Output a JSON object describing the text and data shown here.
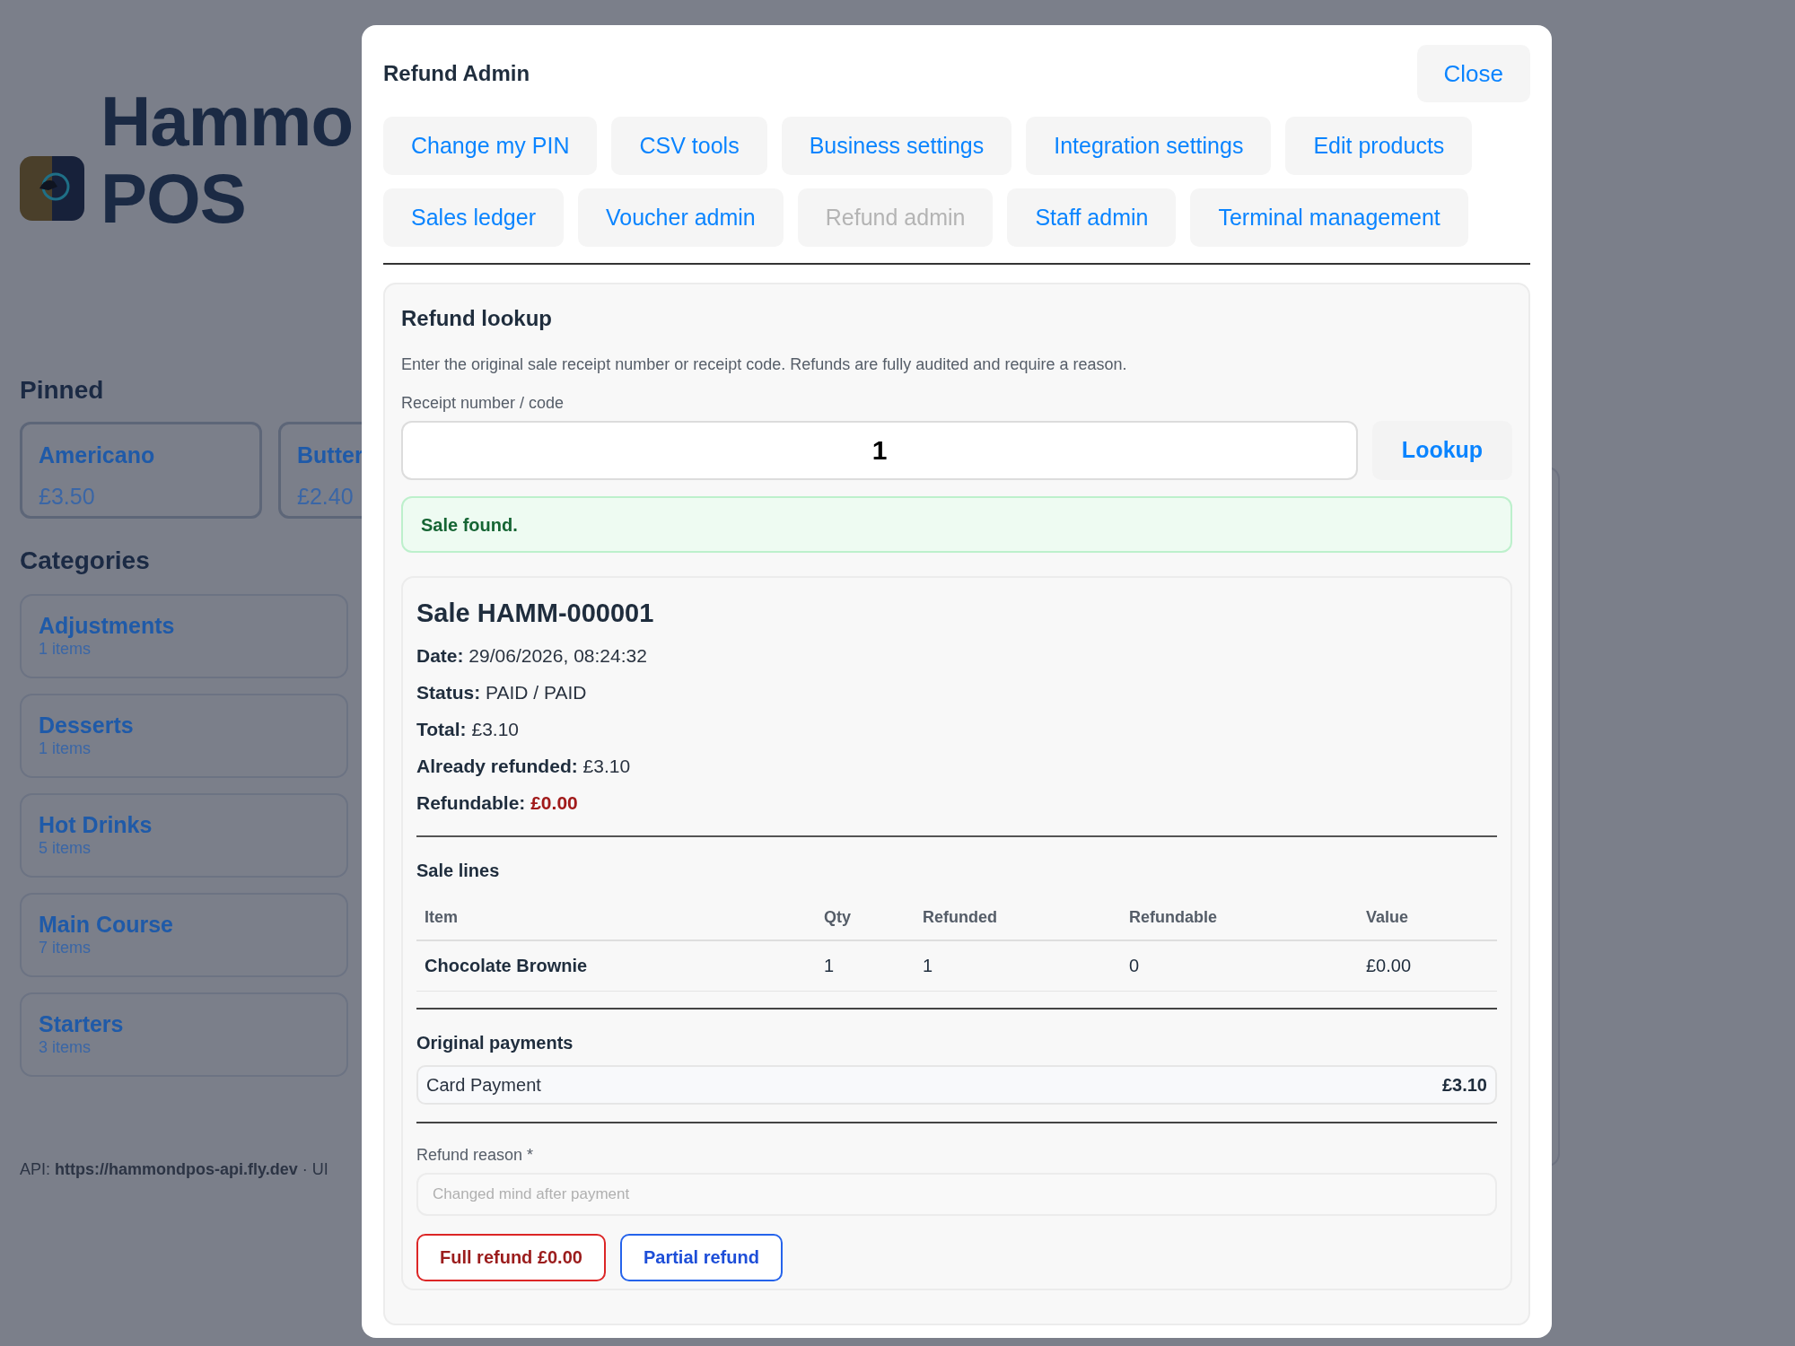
{
  "background": {
    "title_lines": [
      "Hammo",
      "POS"
    ],
    "pinned": {
      "heading": "Pinned",
      "items": [
        {
          "name": "Americano",
          "price": "£3.50"
        },
        {
          "name": "Butter",
          "price": "£2.40"
        }
      ]
    },
    "categories": {
      "heading": "Categories",
      "items": [
        {
          "name": "Adjustments",
          "count": "1 items"
        },
        {
          "name": "Desserts",
          "count": "1 items"
        },
        {
          "name": "Hot Drinks",
          "count": "5 items"
        },
        {
          "name": "Main Course",
          "count": "7 items"
        },
        {
          "name": "Starters",
          "count": "3 items"
        }
      ]
    },
    "footer": "API: **https://hammondpos-api.fly.dev** · UI"
  },
  "modal": {
    "title": "Refund Admin",
    "close": "Close",
    "tabs": [
      {
        "label": "Change my PIN",
        "selected": false
      },
      {
        "label": "CSV tools",
        "selected": false
      },
      {
        "label": "Business settings",
        "selected": false
      },
      {
        "label": "Integration settings",
        "selected": false
      },
      {
        "label": "Edit products",
        "selected": false
      },
      {
        "label": "Sales ledger",
        "selected": false
      },
      {
        "label": "Voucher admin",
        "selected": false
      },
      {
        "label": "Refund admin",
        "selected": true
      },
      {
        "label": "Staff admin",
        "selected": false
      },
      {
        "label": "Terminal management",
        "selected": false
      }
    ],
    "lookup": {
      "heading": "Refund lookup",
      "description": "Enter the original sale receipt number or receipt code. Refunds are fully audited and require a reason.",
      "field_label": "Receipt number / code",
      "value": "1",
      "button": "Lookup",
      "message": "Sale found."
    },
    "sale": {
      "title": "Sale HAMM-000001",
      "fields": [
        {
          "label": "Date:",
          "value": "29/06/2026, 08:24:32",
          "kind": "plain"
        },
        {
          "label": "Status:",
          "value": "PAID / PAID",
          "kind": "plain"
        },
        {
          "label": "Total:",
          "value": "£3.10",
          "kind": "plain"
        },
        {
          "label": "Already refunded:",
          "value": "£3.10",
          "kind": "plain"
        },
        {
          "label": "Refundable:",
          "value": "£0.00",
          "kind": "alert"
        }
      ],
      "lines_heading": "Sale lines",
      "table": {
        "columns": [
          "Item",
          "Qty",
          "Refunded",
          "Refundable",
          "Value"
        ],
        "rows": [
          [
            "Chocolate Brownie",
            "1",
            "1",
            "0",
            "£0.00"
          ]
        ]
      },
      "payments_heading": "Original payments",
      "payments": [
        {
          "method": "Card Payment",
          "amount": "£3.10"
        }
      ],
      "reason_label": "Refund reason *",
      "reason_placeholder": "Changed mind after payment",
      "actions": [
        {
          "label": "Full refund £0.00",
          "kind": "danger"
        },
        {
          "label": "Partial refund",
          "kind": "primary"
        }
      ]
    }
  }
}
